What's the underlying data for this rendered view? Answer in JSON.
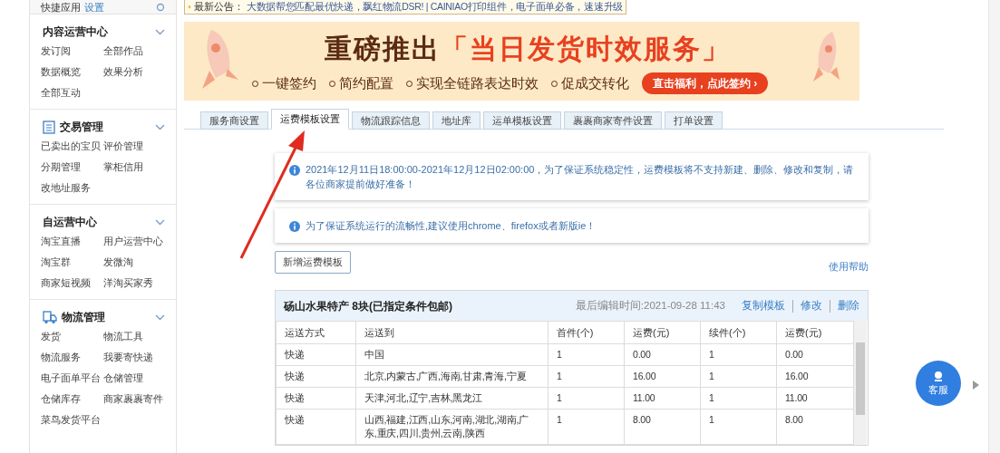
{
  "sidebar": {
    "quick_apps": {
      "label": "快捷应用",
      "link": "设置"
    },
    "sections": [
      {
        "title": "内容运营中心",
        "kind": "plain",
        "expanded": true,
        "items": [
          "发订阅",
          "全部作品",
          "数据概览",
          "效果分析",
          "全部互动"
        ]
      },
      {
        "title": "交易管理",
        "kind": "document",
        "expanded": true,
        "items": [
          "已卖出的宝贝",
          "评价管理",
          "分期管理",
          "掌柜信用",
          "改地址服务"
        ]
      },
      {
        "title": "自运营中心",
        "kind": "plain",
        "expanded": true,
        "items": [
          "淘宝直播",
          "用户运营中心",
          "淘宝群",
          "发微淘",
          "商家短视频",
          "洋淘买家秀"
        ]
      },
      {
        "title": "物流管理",
        "kind": "truck",
        "expanded": true,
        "items": [
          "发货",
          "物流工具",
          "物流服务",
          "我要寄快递",
          "电子面单平台",
          "仓储管理",
          "仓储库存",
          "商家裹裹寄件",
          "菜鸟发货平台"
        ]
      }
    ]
  },
  "announcement": {
    "label": "最新公告：",
    "text": "大数据帮您匹配最优快递，飘红物流DSR! | CAINIAO打印组件，电子面单必备，速速升级"
  },
  "banner": {
    "title_lead": "重磅推出",
    "title_highlight": "「当日发货时效服务」",
    "features": [
      "一键签约",
      "简约配置",
      "实现全链路表达时效",
      "促成交转化"
    ],
    "cta": "直击福利，点此签约 ›"
  },
  "tabs": [
    {
      "label": "服务商设置",
      "selected": false
    },
    {
      "label": "运费模板设置",
      "selected": true
    },
    {
      "label": "物流跟踪信息",
      "selected": false
    },
    {
      "label": "地址库",
      "selected": false
    },
    {
      "label": "运单模板设置",
      "selected": false
    },
    {
      "label": "裹裹商家寄件设置",
      "selected": false
    },
    {
      "label": "打单设置",
      "selected": false
    }
  ],
  "notices": [
    "2021年12月11日18:00:00-2021年12月12日02:00:00，为了保证系统稳定性，运费模板将不支持新建、删除、修改和复制，请各位商家提前做好准备！",
    "为了保证系统运行的流畅性,建议使用chrome、firefox或者新版ie！"
  ],
  "add_button": "新增运费模板",
  "help_link": "使用帮助",
  "template": {
    "name": "砀山水果特产 8块(已指定条件包邮)",
    "last_edited": "最后编辑时间:2021-09-28 11:43",
    "actions": [
      "复制模板",
      "修改",
      "删除"
    ],
    "columns": [
      "运送方式",
      "运送到",
      "首件(个)",
      "运费(元)",
      "续件(个)",
      "运费(元)"
    ],
    "rows": [
      [
        "快递",
        "中国",
        "1",
        "0.00",
        "1",
        "0.00"
      ],
      [
        "快递",
        "北京,内蒙古,广西,海南,甘肃,青海,宁夏",
        "1",
        "16.00",
        "1",
        "16.00"
      ],
      [
        "快递",
        "天津,河北,辽宁,吉林,黑龙江",
        "1",
        "11.00",
        "1",
        "11.00"
      ],
      [
        "快递",
        "山西,福建,江西,山东,河南,湖北,湖南,广东,重庆,四川,贵州,云南,陕西",
        "1",
        "8.00",
        "1",
        "8.00"
      ]
    ]
  },
  "service_button": "客服"
}
